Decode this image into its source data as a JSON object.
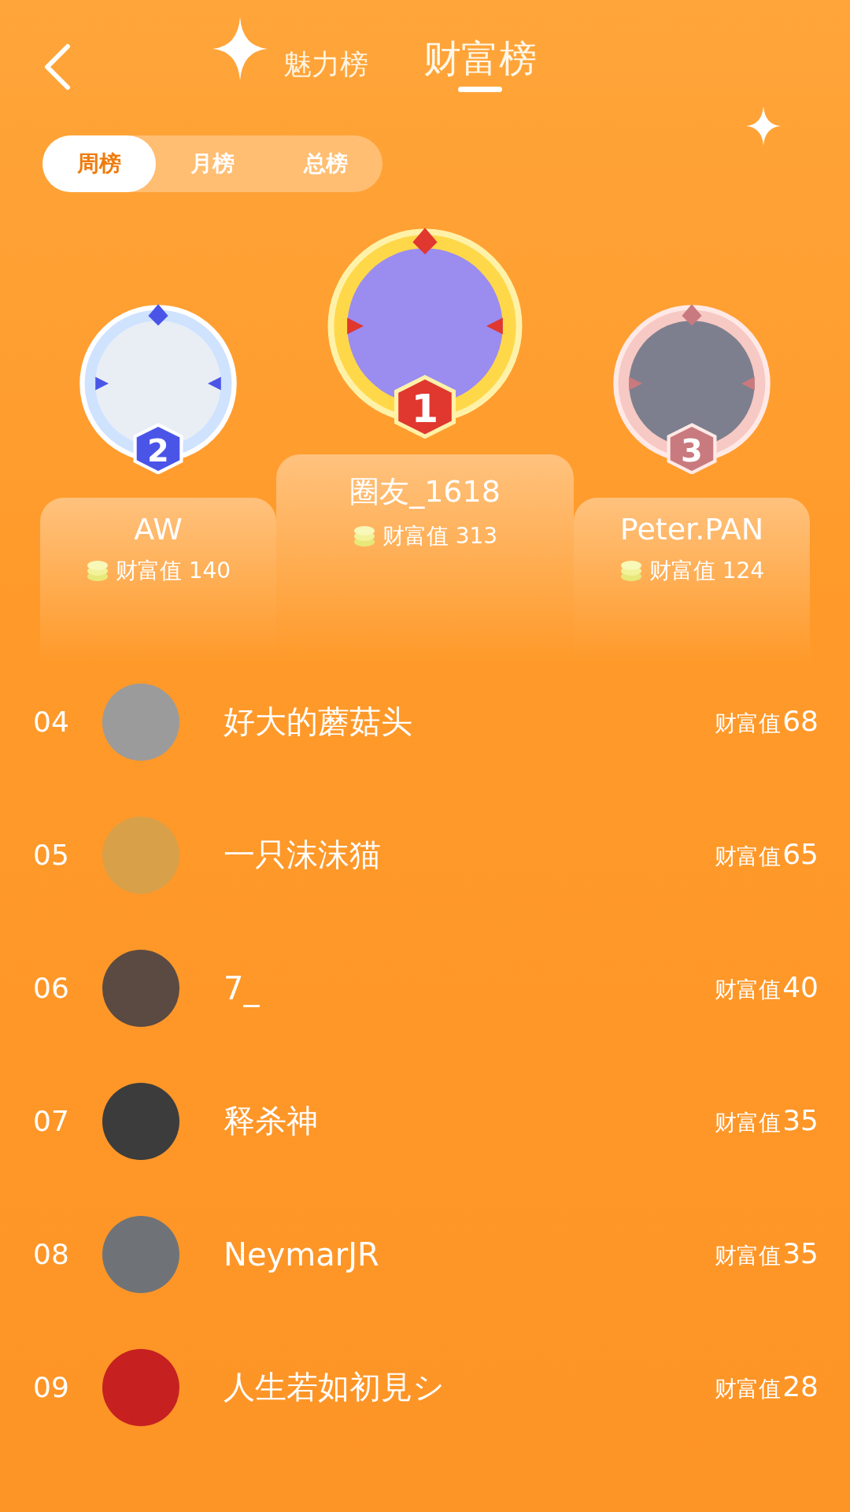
{
  "header": {
    "tabs": [
      {
        "label": "魅力榜",
        "selected": false
      },
      {
        "label": "财富榜",
        "selected": true
      }
    ]
  },
  "periods": [
    {
      "label": "周榜",
      "selected": true
    },
    {
      "label": "月榜",
      "selected": false
    },
    {
      "label": "总榜",
      "selected": false
    }
  ],
  "podium": [
    {
      "rank": "2",
      "name": "AW",
      "value_label": "财富值 140"
    },
    {
      "rank": "1",
      "name": "圈友_1618",
      "value_label": "财富值 313"
    },
    {
      "rank": "3",
      "name": "Peter.PAN",
      "value_label": "财富值 124"
    }
  ],
  "ranking": [
    {
      "rank": "04",
      "name": "好大的蘑菇头",
      "value_label": "财富值",
      "value": "68"
    },
    {
      "rank": "05",
      "name": "一只沫沫猫",
      "value_label": "财富值",
      "value": "65"
    },
    {
      "rank": "06",
      "name": "7_",
      "value_label": "财富值",
      "value": "40"
    },
    {
      "rank": "07",
      "name": "释杀神",
      "value_label": "财富值",
      "value": "35"
    },
    {
      "rank": "08",
      "name": "NeymarJR",
      "value_label": "财富值",
      "value": "35"
    },
    {
      "rank": "09",
      "name": "人生若如初見シ",
      "value_label": "财富值",
      "value": "28"
    }
  ]
}
